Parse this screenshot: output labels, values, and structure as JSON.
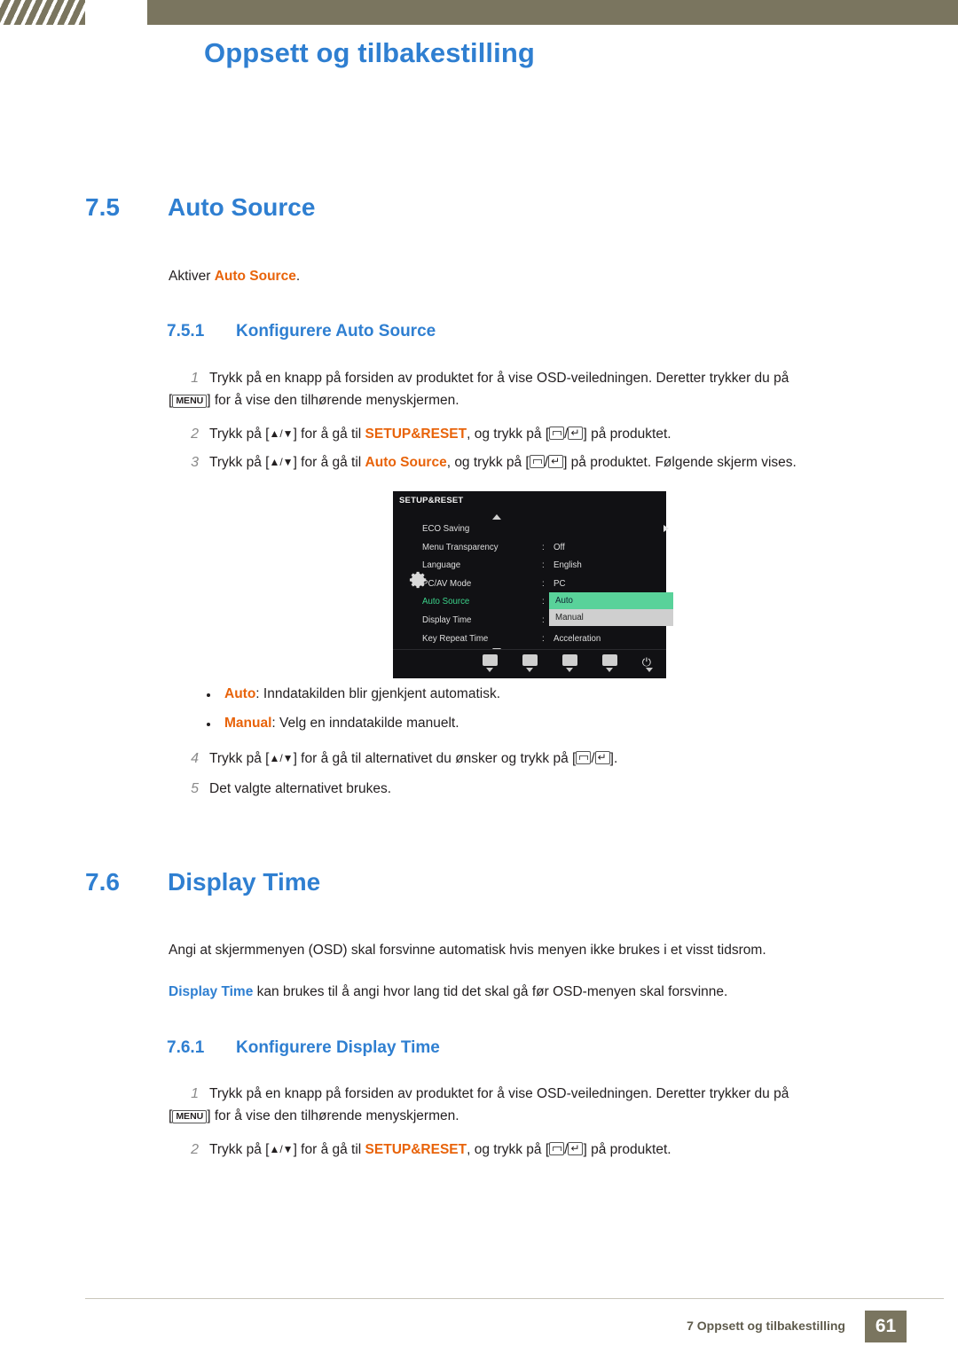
{
  "header": {
    "chapter_title": "Oppsett og tilbakestilling"
  },
  "sections": [
    {
      "number": "7.5",
      "title": "Auto Source",
      "intro_prefix": "Aktiver ",
      "intro_highlight": "Auto Source",
      "intro_suffix": ".",
      "sub_number": "7.5.1",
      "sub_title": "Konfigurere Auto Source"
    },
    {
      "number": "7.6",
      "title": "Display Time",
      "sub_number": "7.6.1",
      "sub_title": "Konfigurere Display Time"
    }
  ],
  "steps_auto_source": [
    {
      "num": "1",
      "line1_a": "Trykk på en knapp på forsiden av produktet for å vise OSD-veiledningen. Deretter trykker du på",
      "line2_key": "MENU",
      "line2_b": "for å vise den tilhørende menyskjermen."
    },
    {
      "num": "2",
      "a": "Trykk på [",
      "arrows": "▲/▼",
      "b": "] for å gå til ",
      "target": "SETUP&RESET",
      "c": ", og trykk på [",
      "d": "] på produktet."
    },
    {
      "num": "3",
      "a": "Trykk på [",
      "arrows": "▲/▼",
      "b": "] for å gå til ",
      "target": "Auto Source",
      "c": ", og trykk på [",
      "d": "] på produktet. Følgende skjerm vises."
    },
    {
      "num": "4",
      "a": "Trykk på [",
      "arrows": "▲/▼",
      "b": "] for å gå til alternativet du ønsker og trykk på [",
      "d": "]."
    },
    {
      "num": "5",
      "a": "Det valgte alternativet brukes."
    }
  ],
  "bullets": [
    {
      "term": "Auto",
      "text": ": Inndatakilden blir gjenkjent automatisk."
    },
    {
      "term": "Manual",
      "text": ": Velg en inndatakilde manuelt."
    }
  ],
  "display_time": {
    "para1": "Angi at skjermmenyen (OSD) skal forsvinne automatisk hvis menyen ikke brukes i et visst tidsrom.",
    "para2_term": "Display Time",
    "para2_rest": " kan brukes til å angi hvor lang tid det skal gå før OSD-menyen skal forsvinne."
  },
  "steps_display_time": [
    {
      "num": "1",
      "line1_a": "Trykk på en knapp på forsiden av produktet for å vise OSD-veiledningen. Deretter trykker du på",
      "line2_key": "MENU",
      "line2_b": "for å vise den tilhørende menyskjermen."
    },
    {
      "num": "2",
      "a": "Trykk på [",
      "arrows": "▲/▼",
      "b": "] for å gå til ",
      "target": "SETUP&RESET",
      "c": ", og trykk på [",
      "d": "] på produktet."
    }
  ],
  "osd": {
    "title": "SETUP&RESET",
    "rows": [
      {
        "label": "ECO Saving",
        "colon": "",
        "value": "",
        "arrow": true,
        "selected": false
      },
      {
        "label": "Menu Transparency",
        "colon": ":",
        "value": "Off",
        "arrow": false,
        "selected": false
      },
      {
        "label": "Language",
        "colon": ":",
        "value": "English",
        "arrow": false,
        "selected": false
      },
      {
        "label": "PC/AV Mode",
        "colon": ":",
        "value": "PC",
        "arrow": false,
        "selected": false
      },
      {
        "label": "Auto Source",
        "colon": ":",
        "value": "",
        "arrow": false,
        "selected": true
      },
      {
        "label": "Display Time",
        "colon": ":",
        "value": "",
        "arrow": false,
        "selected": false
      },
      {
        "label": "Key Repeat Time",
        "colon": ":",
        "value": "Acceleration",
        "arrow": false,
        "selected": false
      }
    ],
    "popup": [
      {
        "label": "Auto",
        "highlighted": true
      },
      {
        "label": "Manual",
        "highlighted": false
      }
    ],
    "power_icon": "⏻"
  },
  "footer": {
    "text": "7 Oppsett og tilbakestilling",
    "page": "61"
  },
  "colors": {
    "accent_blue": "#2f7fd1",
    "accent_orange": "#e8630a",
    "band": "#7a755f",
    "osd_green": "#3bd38a"
  }
}
